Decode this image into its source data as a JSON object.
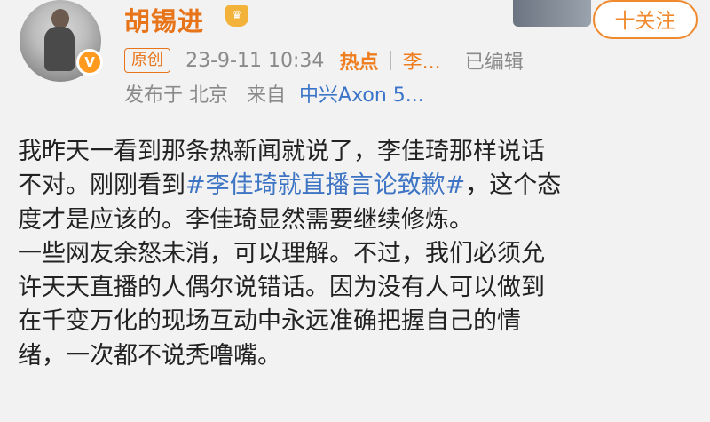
{
  "author": {
    "name": "胡锡进",
    "crown_icon": "crown-icon",
    "verified_icon": "verified-v-icon",
    "avatar_icon": "avatar"
  },
  "follow_button": {
    "label": "十关注"
  },
  "meta": {
    "original_badge": "原创",
    "datetime": "23-9-11 10:34",
    "hot_label": "热点",
    "topic_truncated": "李...",
    "edited": "已编辑",
    "published_in": "发布于 北京",
    "source_prefix": "来自",
    "device": "中兴Axon 5..."
  },
  "post": {
    "line1": "我昨天一看到那条热新闻就说了，李佳琦那样说话",
    "line2_a": "不对。刚刚看到",
    "line2_hashtag": "#李佳琦就直播言论致歉#",
    "line2_b": "，这个态",
    "line3": "度才是应该的。李佳琦显然需要继续修炼。",
    "line4": "一些网友余怒未消，可以理解。不过，我们必须允",
    "line5": "许天天直播的人偶尔说错话。因为没有人可以做到",
    "line6": "在千变万化的现场互动中永远准确把握自己的情",
    "line7": "绪，一次都不说秃噜嘴。"
  },
  "colors": {
    "accent_orange": "#ef7d1e",
    "link_blue": "#3d74c4",
    "meta_gray": "#8a8a8a",
    "background": "#f2f2f2"
  }
}
